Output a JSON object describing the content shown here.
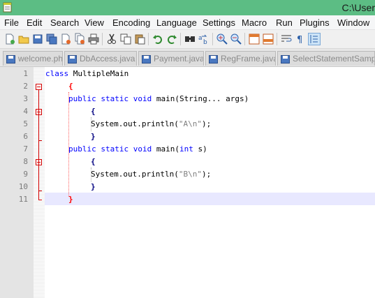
{
  "window": {
    "title": "C:\\User"
  },
  "menu": [
    "File",
    "Edit",
    "Search",
    "View",
    "Encoding",
    "Language",
    "Settings",
    "Macro",
    "Run",
    "Plugins",
    "Window"
  ],
  "toolbar_icons": [
    "new-file-icon",
    "open-file-icon",
    "save-icon",
    "save-all-icon",
    "close-icon",
    "close-all-icon",
    "print-icon",
    "cut-icon",
    "copy-icon",
    "paste-icon",
    "undo-icon",
    "redo-icon",
    "find-icon",
    "replace-icon",
    "zoom-in-icon",
    "zoom-out-icon",
    "sync-vertical-icon",
    "sync-horizontal-icon",
    "word-wrap-icon",
    "show-all-chars-icon",
    "indent-guide-icon"
  ],
  "tabs": [
    {
      "label": "welcome.php",
      "active": false
    },
    {
      "label": "DbAccess.java",
      "active": false
    },
    {
      "label": "Payment.java",
      "active": false
    },
    {
      "label": "RegFrame.java",
      "active": false
    },
    {
      "label": "SelectStatementSample.ja",
      "active": false
    }
  ],
  "line_numbers": [
    "1",
    "2",
    "3",
    "4",
    "5",
    "6",
    "7",
    "8",
    "9",
    "10",
    "11"
  ],
  "code": {
    "l1_kw": "class",
    "l1_rest": " MultipleMain",
    "l2": "{",
    "l3_kw": "public static void",
    "l3_rest": " main(String... args)",
    "l4": "{",
    "l5_pre": "System.out.println(",
    "l5_str": "\"A\\n\"",
    "l5_post": ");",
    "l6": "}",
    "l7_kw": "public static void",
    "l7_mid": " main(",
    "l7_kw2": "int",
    "l7_rest": " s)",
    "l8": "{",
    "l9_pre": "System.out.println(",
    "l9_str": "\"B\\n\"",
    "l9_post": ");",
    "l10": "}",
    "l11": "}"
  },
  "colors": {
    "titlebar": "#5cbd84",
    "keyword": "#0000ff",
    "string": "#808080",
    "brace_match": "#ff0000",
    "current_line": "#e8e8ff"
  }
}
